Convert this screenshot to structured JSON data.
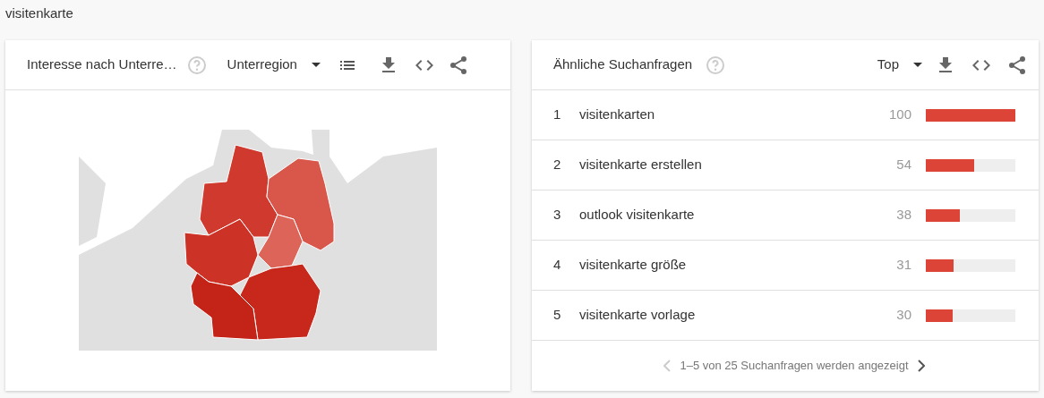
{
  "page_title": "visitenkarte",
  "region_card": {
    "title": "Interesse nach Unterre…",
    "dropdown": "Unterregion"
  },
  "related_card": {
    "title": "Ähnliche Suchanfragen",
    "dropdown": "Top",
    "rows": [
      {
        "rank": "1",
        "query": "visitenkarten",
        "value": "100",
        "level": 1
      },
      {
        "rank": "2",
        "query": "visitenkarte erstellen",
        "value": "54",
        "level": 0.54
      },
      {
        "rank": "3",
        "query": "outlook visitenkarte",
        "value": "38",
        "level": 0.38
      },
      {
        "rank": "4",
        "query": "visitenkarte größe",
        "value": "31",
        "level": 0.31
      },
      {
        "rank": "5",
        "query": "visitenkarte vorlage",
        "value": "30",
        "level": 0.3
      }
    ],
    "pagination": {
      "text": "1–5 von 25 Suchanfragen werden angezeigt",
      "prev_disabled": true,
      "next_disabled": false
    }
  }
}
